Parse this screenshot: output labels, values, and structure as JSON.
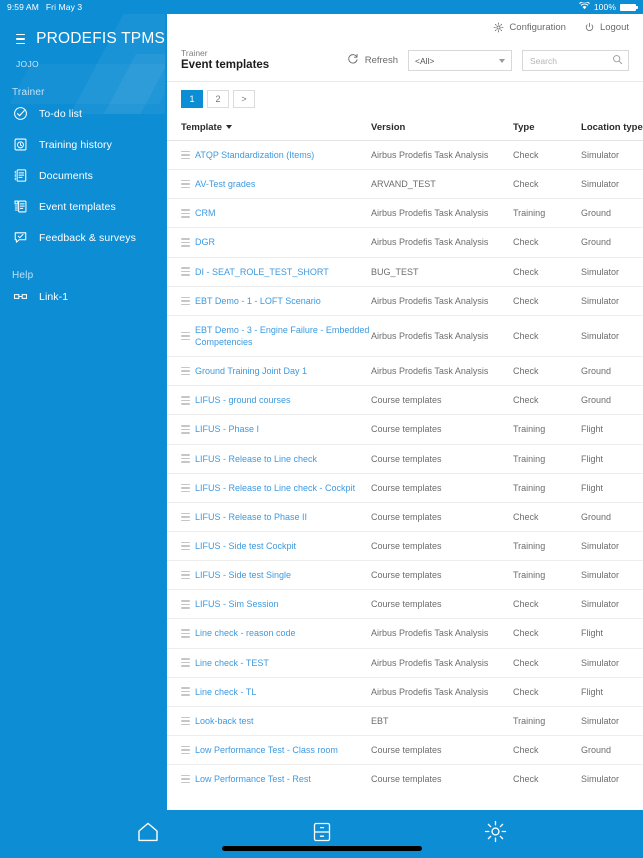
{
  "status_bar": {
    "time": "9:59 AM",
    "date": "Fri May 3",
    "battery": "100%",
    "wifi_icon": "wifi-icon",
    "battery_icon": "battery-icon"
  },
  "sidebar": {
    "menu_icon": "hamburger-icon",
    "app_title": "PRODEFIS TPMS",
    "username": "JOJO",
    "sections": [
      {
        "label": "Trainer",
        "items": [
          {
            "label": "To-do list",
            "icon": "check-circle-icon"
          },
          {
            "label": "Training history",
            "icon": "history-clock-icon"
          },
          {
            "label": "Documents",
            "icon": "document-icon"
          },
          {
            "label": "Event templates",
            "icon": "template-icon"
          },
          {
            "label": "Feedback & surveys",
            "icon": "feedback-icon"
          }
        ]
      },
      {
        "label": "Help",
        "items": [
          {
            "label": "Link-1",
            "icon": "link-icon"
          }
        ]
      }
    ]
  },
  "topbar": {
    "configuration_label": "Configuration",
    "configuration_icon": "gear-icon",
    "logout_label": "Logout",
    "logout_icon": "power-icon"
  },
  "toolbar": {
    "breadcrumb": "Trainer",
    "page_title": "Event templates",
    "refresh_label": "Refresh",
    "refresh_icon": "refresh-icon",
    "filter_value": "<All>",
    "filter_caret_icon": "chevron-down-icon",
    "search_value": "",
    "search_placeholder": "Search",
    "search_icon": "search-icon"
  },
  "pagination": {
    "pages": [
      "1",
      "2"
    ],
    "next_label": ">",
    "active": "1"
  },
  "table": {
    "columns": [
      "Template",
      "Version",
      "Type",
      "Location type"
    ],
    "sort_column": "Template",
    "sort_direction": "desc",
    "row_handle_icon": "drag-handle-icon",
    "rows": [
      {
        "template": "ATQP Standardization (Items)",
        "version": "Airbus Prodefis Task Analysis",
        "type": "Check",
        "location": "Simulator"
      },
      {
        "template": "AV-Test grades",
        "version": "ARVAND_TEST",
        "type": "Check",
        "location": "Simulator"
      },
      {
        "template": "CRM",
        "version": "Airbus Prodefis Task Analysis",
        "type": "Training",
        "location": "Ground"
      },
      {
        "template": "DGR",
        "version": "Airbus Prodefis Task Analysis",
        "type": "Check",
        "location": "Ground"
      },
      {
        "template": "DI - SEAT_ROLE_TEST_SHORT",
        "version": "BUG_TEST",
        "type": "Check",
        "location": "Simulator"
      },
      {
        "template": "EBT Demo - 1 - LOFT Scenario",
        "version": "Airbus Prodefis Task Analysis",
        "type": "Check",
        "location": "Simulator"
      },
      {
        "template": "EBT Demo - 3 - Engine Failure - Embedded Competencies",
        "version": "Airbus Prodefis Task Analysis",
        "type": "Check",
        "location": "Simulator"
      },
      {
        "template": "Ground Training Joint Day 1",
        "version": "Airbus Prodefis Task Analysis",
        "type": "Check",
        "location": "Ground"
      },
      {
        "template": "LIFUS - ground courses",
        "version": "Course templates",
        "type": "Check",
        "location": "Ground"
      },
      {
        "template": "LIFUS - Phase I",
        "version": "Course templates",
        "type": "Training",
        "location": "Flight"
      },
      {
        "template": "LIFUS - Release to Line check",
        "version": "Course templates",
        "type": "Training",
        "location": "Flight"
      },
      {
        "template": "LIFUS - Release to Line check - Cockpit",
        "version": "Course templates",
        "type": "Training",
        "location": "Flight"
      },
      {
        "template": "LIFUS - Release to Phase II",
        "version": "Course templates",
        "type": "Check",
        "location": "Ground"
      },
      {
        "template": "LIFUS - Side test Cockpit",
        "version": "Course templates",
        "type": "Training",
        "location": "Simulator"
      },
      {
        "template": "LIFUS - Side test Single",
        "version": "Course templates",
        "type": "Training",
        "location": "Simulator"
      },
      {
        "template": "LIFUS - Sim Session",
        "version": "Course templates",
        "type": "Check",
        "location": "Simulator"
      },
      {
        "template": "Line check - reason code",
        "version": "Airbus Prodefis Task Analysis",
        "type": "Check",
        "location": "Flight"
      },
      {
        "template": "Line check - TEST",
        "version": "Airbus Prodefis Task Analysis",
        "type": "Check",
        "location": "Simulator"
      },
      {
        "template": "Line check - TL",
        "version": "Airbus Prodefis Task Analysis",
        "type": "Check",
        "location": "Flight"
      },
      {
        "template": "Look-back test",
        "version": "EBT",
        "type": "Training",
        "location": "Simulator"
      },
      {
        "template": "Low Performance Test - Class room",
        "version": "Course templates",
        "type": "Check",
        "location": "Ground"
      },
      {
        "template": "Low Performance Test - Rest",
        "version": "Course templates",
        "type": "Check",
        "location": "Simulator"
      }
    ]
  },
  "bottom_nav": [
    {
      "icon": "home-icon",
      "name": "home-button"
    },
    {
      "icon": "drawer-icon",
      "name": "recents-button"
    },
    {
      "icon": "gear-icon",
      "name": "settings-button"
    }
  ],
  "colors": {
    "brand": "#0d8dd4",
    "link": "#3d9ae0",
    "text": "#6d6d6d"
  }
}
